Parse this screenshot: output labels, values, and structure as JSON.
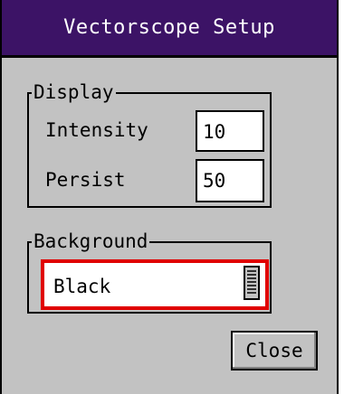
{
  "dialog": {
    "title": "Vectorscope Setup",
    "title_bg": "#3c1366",
    "window_bg": "#c2c2c2"
  },
  "display_group": {
    "legend": "Display",
    "intensity_label": "Intensity",
    "intensity_value": "10",
    "persist_label": "Persist",
    "persist_value": "50"
  },
  "background_group": {
    "legend": "Background",
    "selected_value": "Black",
    "focus_color": "#e00000",
    "handle_icon": "scroll-grip-icon"
  },
  "buttons": {
    "close_label": "Close"
  }
}
